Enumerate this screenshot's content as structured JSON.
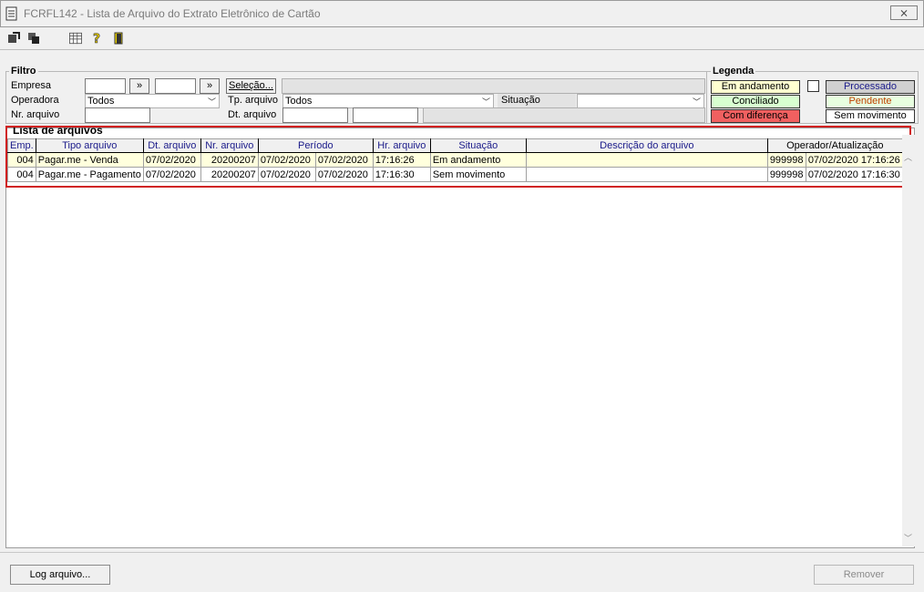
{
  "window": {
    "title": "FCRFL142 - Lista de Arquivo do Extrato Eletrônico de Cartão",
    "close_glyph": "⨯"
  },
  "filter": {
    "group_label": "Filtro",
    "empresa_label": "Empresa",
    "empresa_from": "",
    "empresa_to": "",
    "lookup_glyph": "»",
    "selecao_label": "Seleção...",
    "operadora_label": "Operadora",
    "operadora_value": "Todos",
    "tp_arquivo_label": "Tp. arquivo",
    "tp_arquivo_value": "Todos",
    "situacao_label": "Situação",
    "situacao_value": "",
    "nr_arquivo_label": "Nr. arquivo",
    "nr_arquivo_value": "",
    "dt_arquivo_label": "Dt. arquivo",
    "dt_arquivo_from": "",
    "dt_arquivo_to": ""
  },
  "legend": {
    "group_label": "Legenda",
    "em_andamento": "Em andamento",
    "processado": "Processado",
    "conciliado": "Conciliado",
    "pendente": "Pendente",
    "com_diferenca": "Com diferença",
    "sem_movimento": "Sem movimento",
    "colors": {
      "em_andamento": "#ffffd0",
      "processado": "#d0d0d0",
      "conciliado": "#d8ffd0",
      "pendente": "#e8ffe0",
      "com_diferenca": "#f06060",
      "sem_movimento": "#ffffff"
    }
  },
  "list": {
    "group_label": "Lista de arquivos",
    "columns": [
      "Emp.",
      "Tipo arquivo",
      "Dt. arquivo",
      "Nr. arquivo",
      "Período",
      "Hr. arquivo",
      "Situação",
      "Descrição do arquivo",
      "Operador/Atualização"
    ],
    "rows": [
      {
        "emp": "004",
        "tipo": "Pagar.me - Venda",
        "dt": "07/02/2020",
        "nr": "20200207",
        "periodo_ini": "07/02/2020",
        "periodo_fim": "07/02/2020",
        "hr": "17:16:26",
        "situacao": "Em andamento",
        "descricao": "",
        "operador": "999998",
        "atualizacao": "07/02/2020 17:16:26"
      },
      {
        "emp": "004",
        "tipo": "Pagar.me - Pagamento",
        "dt": "07/02/2020",
        "nr": "20200207",
        "periodo_ini": "07/02/2020",
        "periodo_fim": "07/02/2020",
        "hr": "17:16:30",
        "situacao": "Sem movimento",
        "descricao": "",
        "operador": "999998",
        "atualizacao": "07/02/2020 17:16:30"
      }
    ]
  },
  "footer": {
    "log_button": "Log arquivo...",
    "remover_button": "Remover"
  }
}
